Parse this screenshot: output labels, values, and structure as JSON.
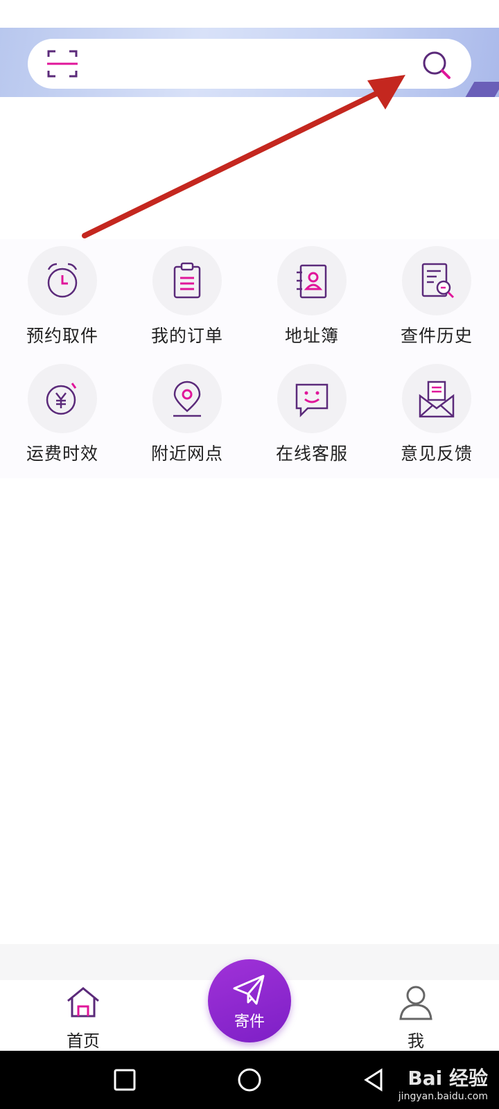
{
  "colors": {
    "accent": "#e0169a",
    "icon_stroke": "#5b2a7a",
    "primary": "#8a25cc"
  },
  "header": {
    "scan_icon": "scan-icon",
    "search_icon": "search-icon"
  },
  "services": [
    {
      "label": "预约取件",
      "icon": "alarm-clock-icon"
    },
    {
      "label": "我的订单",
      "icon": "clipboard-icon"
    },
    {
      "label": "地址簿",
      "icon": "contact-book-icon"
    },
    {
      "label": "查件历史",
      "icon": "document-search-icon"
    },
    {
      "label": "运费时效",
      "icon": "yuan-timer-icon"
    },
    {
      "label": "附近网点",
      "icon": "location-pin-icon"
    },
    {
      "label": "在线客服",
      "icon": "chat-smile-icon"
    },
    {
      "label": "意见反馈",
      "icon": "envelope-icon"
    }
  ],
  "tabbar": {
    "home_label": "首页",
    "send_label": "寄件",
    "me_label": "我"
  },
  "watermark": {
    "main": "Bai 经验",
    "sub": "jingyan.baidu.com"
  }
}
